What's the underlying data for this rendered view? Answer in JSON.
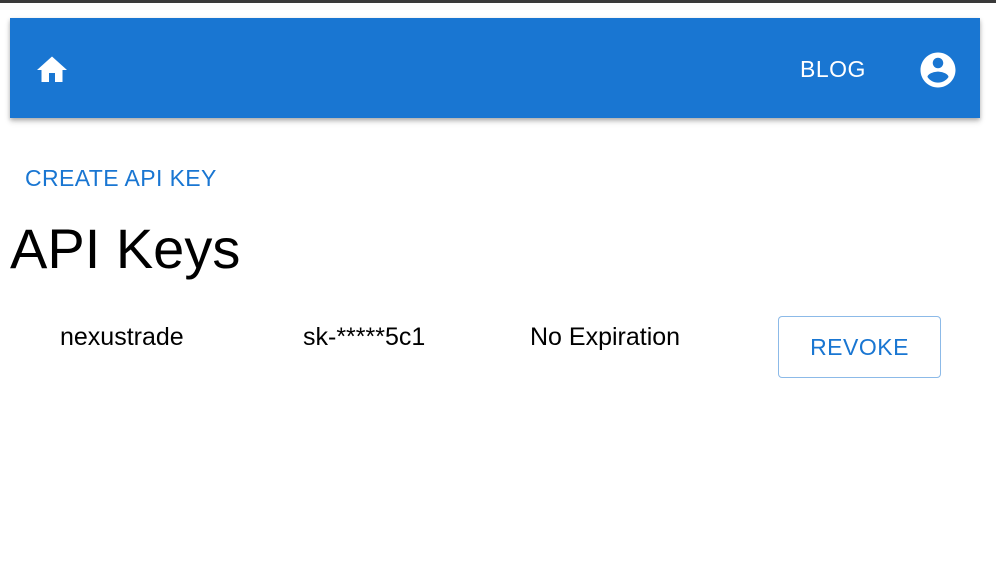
{
  "app_bar": {
    "home_icon": "home-icon",
    "blog_label": "BLOG",
    "account_icon": "account-circle-icon",
    "color": "#1976d2"
  },
  "page": {
    "create_label": "CREATE API KEY",
    "title": "API Keys"
  },
  "api_keys": [
    {
      "name": "nexustrade",
      "key": "sk-*****5c1",
      "expiration": "No Expiration",
      "action_label": "REVOKE"
    }
  ]
}
